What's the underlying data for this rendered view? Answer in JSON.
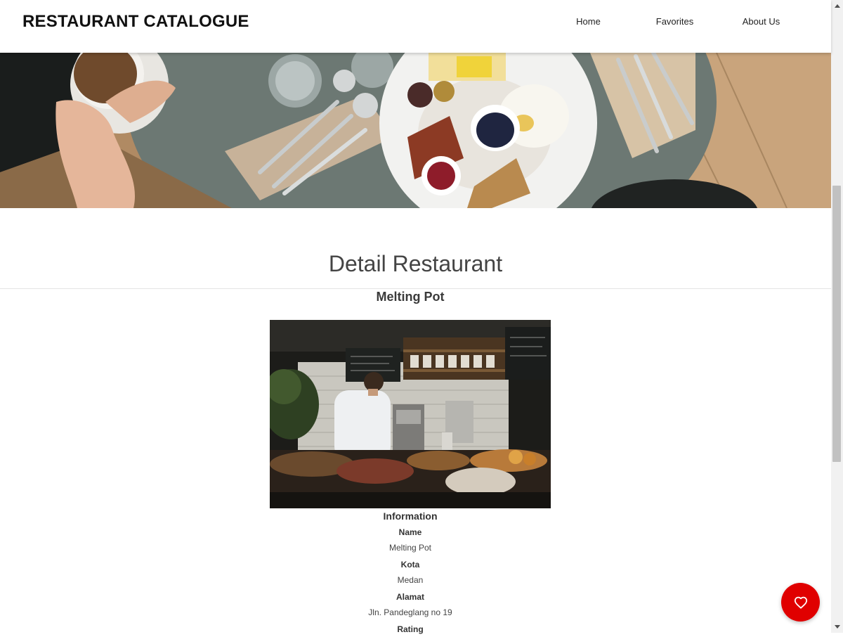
{
  "header": {
    "brand": "RESTAURANT CATALOGUE",
    "nav": [
      "Home",
      "Favorites",
      "About Us"
    ]
  },
  "hero": {
    "icon": "breakfast-table-photo"
  },
  "main": {
    "heading": "Detail Restaurant",
    "restaurant_name": "Melting Pot",
    "photo": "restaurant-kitchen-photo",
    "information": {
      "title": "Information",
      "fields": [
        {
          "label": "Name",
          "value": "Melting Pot"
        },
        {
          "label": "Kota",
          "value": "Medan"
        },
        {
          "label": "Alamat",
          "value": "Jln. Pandeglang no 19"
        },
        {
          "label": "Rating",
          "value": ""
        }
      ]
    }
  },
  "favorite_button": {
    "icon": "heart-icon",
    "color": "#e00000"
  }
}
